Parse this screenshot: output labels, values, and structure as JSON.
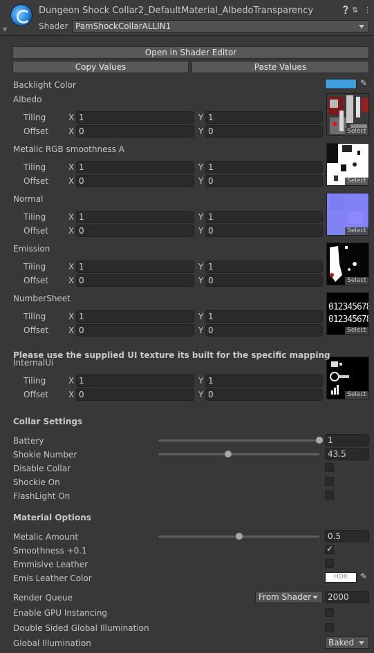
{
  "header": {
    "title": "Dungeon Shock Collar2_DefaultMaterial_AlbedoTransparency",
    "shader_label": "Shader",
    "shader_value": "PamShockCollarALLIN1",
    "icons": [
      "help-icon",
      "preset-icon",
      "more-icon"
    ]
  },
  "buttons": {
    "open_shader_editor": "Open in Shader Editor",
    "copy_values": "Copy Values",
    "paste_values": "Paste Values"
  },
  "backlight": {
    "label": "Backlight Color",
    "color": "#3f9fdc"
  },
  "textures": [
    {
      "label": "Albedo",
      "tiling_label": "Tiling",
      "offset_label": "Offset",
      "tiling_x": "1",
      "tiling_y": "1",
      "offset_x": "0",
      "offset_y": "0",
      "select": "Select"
    },
    {
      "label": "Metalic RGB smoothness A",
      "tiling_label": "Tiling",
      "offset_label": "Offset",
      "tiling_x": "1",
      "tiling_y": "1",
      "offset_x": "0",
      "offset_y": "0",
      "select": "Select"
    },
    {
      "label": "Normal",
      "tiling_label": "Tiling",
      "offset_label": "Offset",
      "tiling_x": "1",
      "tiling_y": "1",
      "offset_x": "0",
      "offset_y": "0",
      "select": "Select"
    },
    {
      "label": "Emission",
      "tiling_label": "Tiling",
      "offset_label": "Offset",
      "tiling_x": "1",
      "tiling_y": "1",
      "offset_x": "0",
      "offset_y": "0",
      "select": "Select"
    },
    {
      "label": "NumberSheet",
      "tiling_label": "Tiling",
      "offset_label": "Offset",
      "tiling_x": "1",
      "tiling_y": "1",
      "offset_x": "0",
      "offset_y": "0",
      "select": "Select"
    },
    {
      "label": "InternalUi",
      "tiling_label": "Tiling",
      "offset_label": "Offset",
      "tiling_x": "1",
      "tiling_y": "1",
      "offset_x": "0",
      "offset_y": "0",
      "select": "Select"
    }
  ],
  "xy": {
    "x": "X",
    "y": "Y"
  },
  "ui_notice": "Please use the supplied UI texture its built for the specific mapping",
  "collar_settings": {
    "title": "Collar Settings",
    "battery_label": "Battery",
    "battery_value": "1",
    "battery_fraction": 1.0,
    "shokie_label": "Shokie Number",
    "shokie_value": "43.5",
    "shokie_fraction": 0.435,
    "disable_label": "Disable Collar",
    "disable_checked": false,
    "shockie_on_label": "Shockie On",
    "shockie_on_checked": false,
    "flashlight_label": "FlashLight On",
    "flashlight_checked": false
  },
  "material_options": {
    "title": "Material Options",
    "metalic_label": "Metalic Amount",
    "metalic_value": "0.5",
    "metalic_fraction": 0.5,
    "smoothness_label": "Smoothness +0.1",
    "smoothness_checked": true,
    "emmisive_label": "Emmisive Leather",
    "emmisive_checked": false,
    "emis_color_label": "Emis Leather Color",
    "emis_color": "#ffffff",
    "emis_hdr": "HDR"
  },
  "render": {
    "queue_label": "Render Queue",
    "queue_source": "From Shader",
    "queue_value": "2000",
    "gpu_label": "Enable GPU Instancing",
    "gpu_checked": false,
    "double_sided_label": "Double Sided Global Illumination",
    "double_sided_checked": false,
    "gi_label": "Global Illumination",
    "gi_value": "Baked"
  }
}
